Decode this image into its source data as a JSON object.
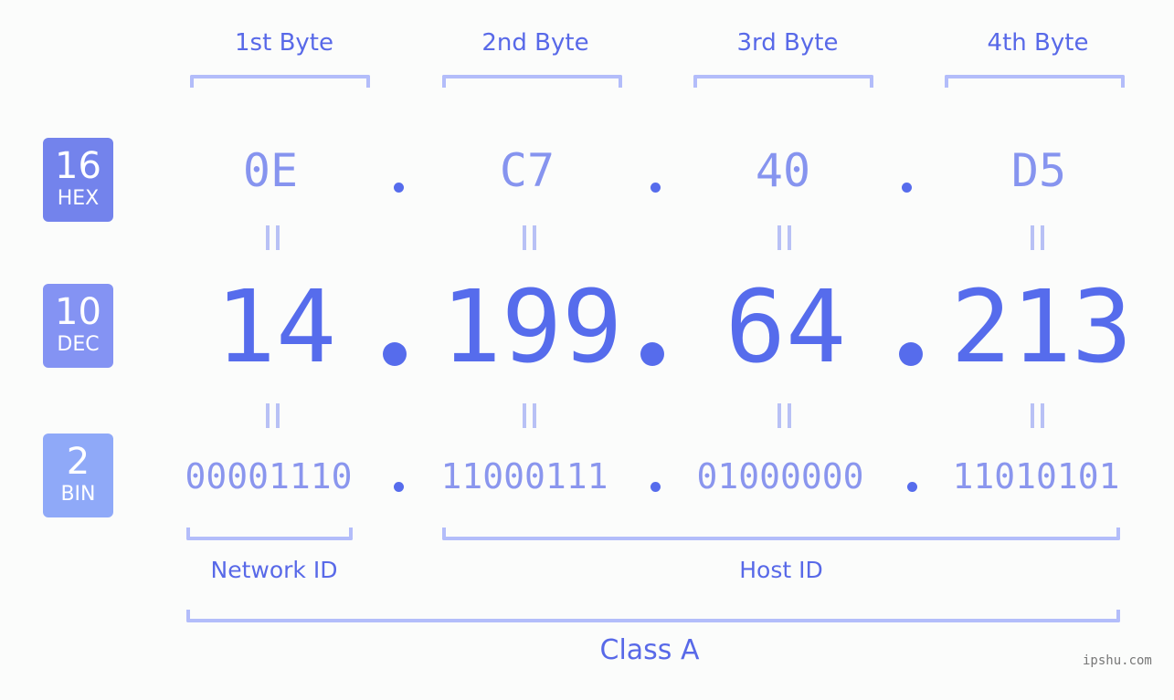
{
  "byte_headers": [
    "1st Byte",
    "2nd Byte",
    "3rd Byte",
    "4th Byte"
  ],
  "badges": {
    "hex": {
      "num": "16",
      "unit": "HEX",
      "color": "#7383ec"
    },
    "dec": {
      "num": "10",
      "unit": "DEC",
      "color": "#8493f3"
    },
    "bin": {
      "num": "2",
      "unit": "BIN",
      "color": "#8fa9f8"
    }
  },
  "hex_values": [
    "0E",
    "C7",
    "40",
    "D5"
  ],
  "dec_values": [
    "14",
    "199",
    "64",
    "213"
  ],
  "bin_values": [
    "00001110",
    "11000111",
    "01000000",
    "11010101"
  ],
  "separator": ".",
  "equals_symbol": "=",
  "network_id_label": "Network ID",
  "host_id_label": "Host ID",
  "class_label": "Class A",
  "watermark": "ipshu.com",
  "colors": {
    "accent": "#566cec",
    "hex_text": "#8694ef",
    "bin_text": "#8a96ee",
    "bracket": "#b3bdfa",
    "background": "#fbfcfb"
  }
}
